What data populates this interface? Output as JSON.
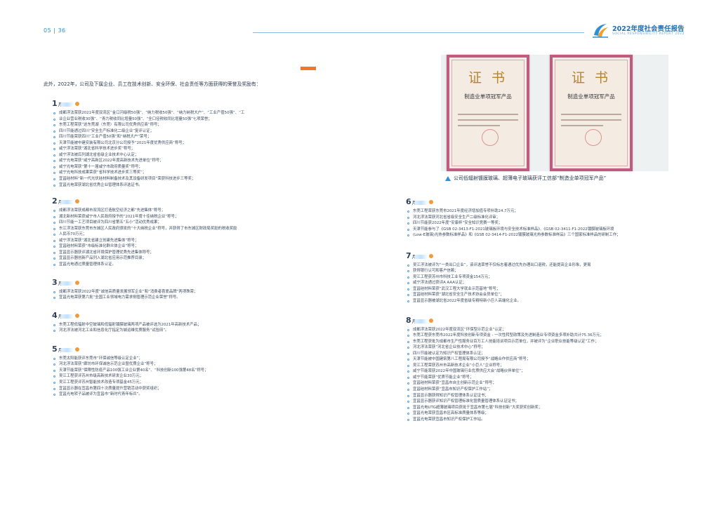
{
  "header": {
    "page_number": "05 | 36",
    "report_title": "2022年度社会责任报告",
    "report_subtitle": "SOCIAL RESPONSIBILITY REPORT 2022"
  },
  "intro": "此外，2022年，公司及下属企业、员工在技术创新、安全环保、社会责任等方面获得的荣誉及奖励有：",
  "month_suffix": "月",
  "photo": {
    "cert_title": "证 书",
    "cert_subtitle": "制造业单项冠军产品",
    "caption": "公司低辐射镀膜玻璃、超薄电子玻璃获评工信部“制造业单项冠军产品”"
  },
  "months_left": [
    {
      "num": "1",
      "items": [
        "成都浮法荣获2021年度双流区“金口河级税50强”、“纳力税收50强”、“纳力纳税大户”、“工业产值50强”、“工",
        "业企业营业税收30强”、“青力税收同比增量50强”、“全口径税收同比增量50强”七项荣誉；",
        "东莞工程荣获“这东莞湖（东莞）有限公司优秀供应商”称号；",
        "四川节能通过四川“安全生产标准化二级企业”复评认证；",
        "四川节能荣获四川“工业产值50强”和“纳税大户”荣号；",
        "天津节能被中建安装有限公司北京分公司授予“2021年度优秀供应商”称号；",
        "咸宁浮法荣获“湖北省科学技术进步奖”称号；",
        "咸宁浮法被后列湖北省省级企业技术中心认定；",
        "咸宁光电荣获“咸宁高新区2022年度高新技术先进单位”称号；",
        "咸宁光电荣获“第十一届咸宁市政府质量奖”称号；",
        "咸宁光电科技成果荣获“省科学技术进步奖三等奖”；",
        "宜昌硅材料“新一代光伏硅材料制备技术及其设备研发项目”荣获科技进步三等奖；",
        "宜昌光电荣获湖北省优秀企业管理体系评选证书。"
      ]
    },
    {
      "num": "2",
      "items": [
        "成都浮法荣获成都市双流区打造航空经济之都“先进集体”称号；",
        "湖北新材料荣获咸宁市人民政府授予的“2021年度十佳纳税企业”称号；",
        "四川节能一工艺项目被评为四川省第五“五小”活动优秀成果；",
        "东江浮法荣获东莞市东城区人民政府颁发的“十大纳税企业”称号，并获得了市东城区财政局奖励的税收奖励",
        "人民币70万元；",
        "咸宁浮法荣获“湖北省建立创建先进集体”称号；",
        "宜昌硅材料荣获“市级标准化群众体企业”称号；",
        "宜昌显示器获评湖北省环境保护管理优秀先进集体称号；",
        "宜昌显示器创新产品列入湖北省应用示范推荐目录；",
        "宜昌光电通过质量管理体系认证。"
      ]
    },
    {
      "num": "3",
      "items": [
        "成都浮法荣获2022年度“诚信高质量发展领军企业”和“消费者喜爱品牌”两项殊荣；",
        "宜昌光电荣获第六批“全国工业领域电力需求侧管理示范企业荣誉”称号。"
      ]
    },
    {
      "num": "4",
      "items": [
        "东莞工程低辐射中空玻璃和低辐射镀膜玻璃两项产品被评选为2021年高新技术产品；",
        "河北浮法被河北工业和信息化厅指定为城运维优质服务“试验田”。"
      ]
    },
    {
      "num": "5",
      "items": [
        "东莞太阳能获评东莞市“环保诚信等级认定企业”；",
        "河北浮法荣获“廊坊市环保诚信示范企业暨优质企业”称号；",
        "天津节能荣获“保障性防疫产品100强工业企业第40名”、“科技创新100强第48名”称号；",
        "吴江工程获评苏州市级高新技术研发企业30万元；",
        "吴江工程获评苏州智能技术改造专项基金45万元；",
        "宜昌显示器在宜昌市第四十次质量提升营销活动中获奖组织；",
        "宜昌光电转子品被评为宜昌市“新时代青年标兵”。"
      ]
    }
  ],
  "months_right": [
    {
      "num": "6",
      "items": [
        "东莞工程荣获东莞市2021年度经济增加值专项补助24.7万元；",
        "河北浮法荣获河北省省级安全生产二级标准化评审；",
        "四川节能获2022年度“安康杯”安全知识竞赛一等奖；",
        "天津节能参与了《GSB 02-3413-F1-2021玻璃板环境与安全技术标准样品》、《GSB 02-3411-F1-2022镀膜玻璃板环境",
        "(Low-E玻璃)光热参数标准样品》和《GSB 02-3414-F1-2022镀膜玻璃光热参数标准样品》三个国家标准样品的研制工作；"
      ]
    },
    {
      "num": "7",
      "items": [
        "吴江浮法被评为“一类出口企业”，该评选荣誉不仅标志着通过优先办理出口退税，还能提高企业形象，更易",
        "获得银行认可和客户信赖；",
        "吴江工程获苏州市科技工业专项资金154万元；",
        "咸宁浮法通过获评A AAA认证；",
        "宜昌硅材料荣获“武汉工程大学就业示范基地”称号；",
        "宜昌硅材料荣获“湖北省安全生产技术协会会员单位”；",
        "宜昌显示器被湖北省2022年度省级专精特新小巨人高端化企业。"
      ]
    },
    {
      "num": "8",
      "items": [
        "成都浮法荣获2022年度双流区“环保型示范企业”认定；",
        "东莞工程获东莞市2022年度科技创新专项资金 - 一次性转型政策及先进制造业专项资金多项补助共计75.36万元；",
        "东莞工程获批为成都市生产性服务业百万工人技能培训项目示范单位，并被评为“企业职业技能等级认定”工作；",
        "河北浮法荣获“河北省企业技术中心”称号；",
        "四川节能被认定为知识产权管理体系认证；",
        "天津节能被中国建筑第八工程局有限公司授予“战略合作供应商”称号；",
        "吴江工程荣获苏州市高新技术企业“小巨人”企业称号；",
        "咸宁节能荣获2022年中国玻璃行业优质供应大会“战略伙伴单位”；",
        "咸宁节能荣获“优质节能企业”称号；",
        "宜昌硅材料荣获“宜昌市自主创新示范企业”称号；",
        "宜昌硅材料荣获“宜昌市知识产权保护工作站”；",
        "宜昌显示器获得知识产权管理体系认证证书；",
        "宜昌显示器获评知识产权管理标准化暨质量管理体系认证证书；",
        "宜昌光电UTG超薄玻璃项目获批于宜昌市第七届“科技创新”大奖获奖创新奖；",
        "宜昌光电荣获宜昌市区高标准质量体系等级；",
        "宜昌光电荣获宜昌市知识产权保护工作站。"
      ]
    }
  ]
}
